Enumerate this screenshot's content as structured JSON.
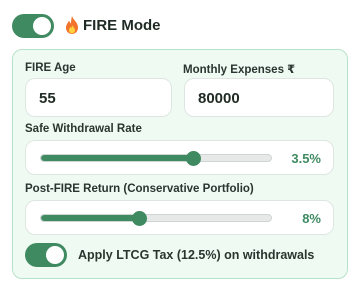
{
  "header": {
    "title": "FIRE Mode",
    "toggle_on": true,
    "icon": "fire-icon"
  },
  "fields": {
    "fire_age": {
      "label": "FIRE Age",
      "value": "55"
    },
    "monthly_expenses": {
      "label": "Monthly Expenses ₹",
      "value": "80000"
    }
  },
  "sliders": {
    "swr": {
      "label": "Safe Withdrawal Rate",
      "value_text": "3.5%",
      "position": 0.66
    },
    "post_fire_return": {
      "label": "Post-FIRE Return (Conservative Portfolio)",
      "value_text": "8%",
      "position": 0.43
    }
  },
  "ltcg": {
    "label": "Apply LTCG Tax (12.5%) on withdrawals",
    "toggle_on": true
  },
  "colors": {
    "accent": "#3f8a61",
    "panel_bg": "#effaf3",
    "panel_border": "#b8e2c7"
  }
}
